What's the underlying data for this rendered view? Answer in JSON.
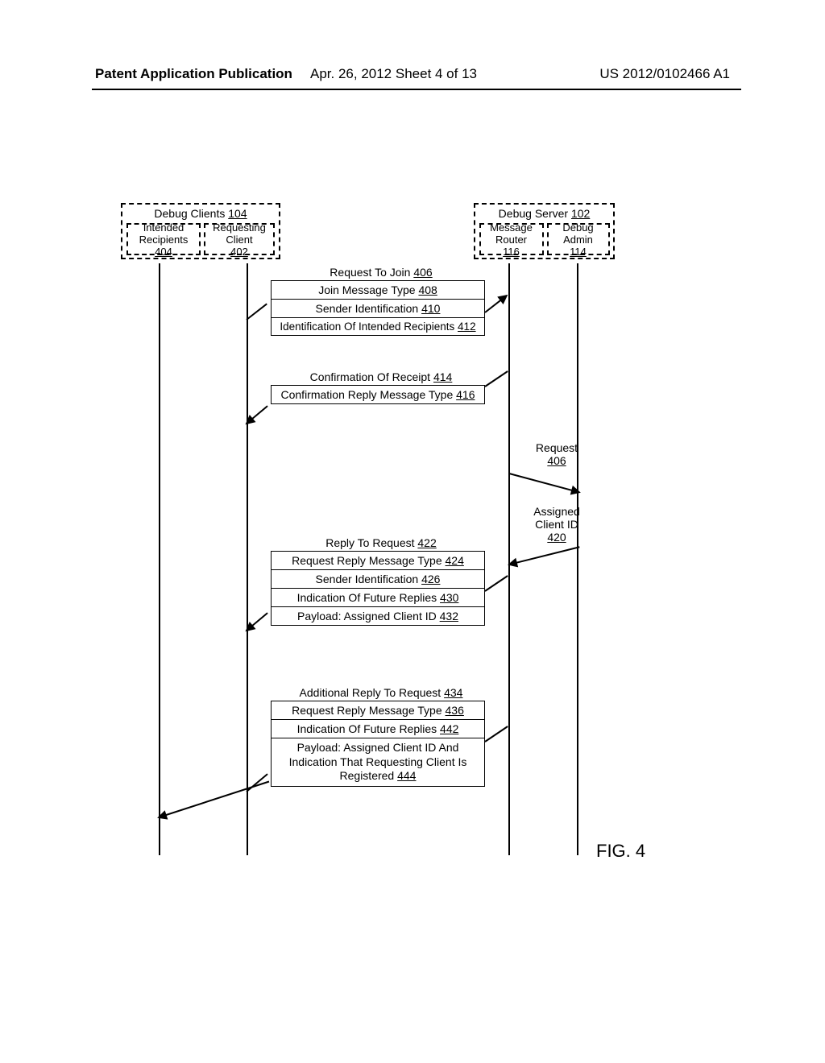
{
  "header": {
    "left": "Patent Application Publication",
    "mid": "Apr. 26, 2012  Sheet 4 of 13",
    "right": "US 2012/0102466 A1"
  },
  "clients": {
    "title": "Debug Clients ",
    "title_ref": "104",
    "intended": "Intended Recipients ",
    "intended_ref": "404",
    "requesting": "Requesting Client ",
    "requesting_ref": "402"
  },
  "server": {
    "title": "Debug Server ",
    "title_ref": "102",
    "router": "Message Router ",
    "router_ref": "116",
    "admin": "Debug Admin ",
    "admin_ref": "114"
  },
  "seq": {
    "m1": {
      "label": "Request To Join ",
      "ref": "406"
    },
    "m1_rows": [
      {
        "text": "Join Message Type ",
        "ref": "408"
      },
      {
        "text": "Sender Identification ",
        "ref": "410"
      },
      {
        "text": "Identification Of Intended Recipients ",
        "ref": "412"
      }
    ],
    "m2": {
      "label": "Confirmation Of Receipt ",
      "ref": "414"
    },
    "m2_rows": [
      {
        "text": "Confirmation Reply Message Type ",
        "ref": "416"
      }
    ],
    "r1": {
      "label": "Request",
      "ref": "406"
    },
    "r2a": "Assigned",
    "r2b": "Client ID",
    "r2_ref": "420",
    "m3": {
      "label": "Reply To Request ",
      "ref": "422"
    },
    "m3_rows": [
      {
        "text": "Request Reply Message Type ",
        "ref": "424"
      },
      {
        "text": "Sender Identification ",
        "ref": "426"
      },
      {
        "text": "Indication Of Future Replies ",
        "ref": "430"
      },
      {
        "text": "Payload: Assigned Client ID  ",
        "ref": "432"
      }
    ],
    "m4": {
      "label": "Additional Reply To Request ",
      "ref": "434"
    },
    "m4_rows": [
      {
        "text": "Request Reply Message Type ",
        "ref": "436"
      },
      {
        "text": "Indication Of Future Replies ",
        "ref": "442"
      },
      {
        "text": "Payload: Assigned Client ID  And Indication That Requesting Client Is Registered ",
        "ref": "444"
      }
    ]
  },
  "figure": "FIG. 4"
}
